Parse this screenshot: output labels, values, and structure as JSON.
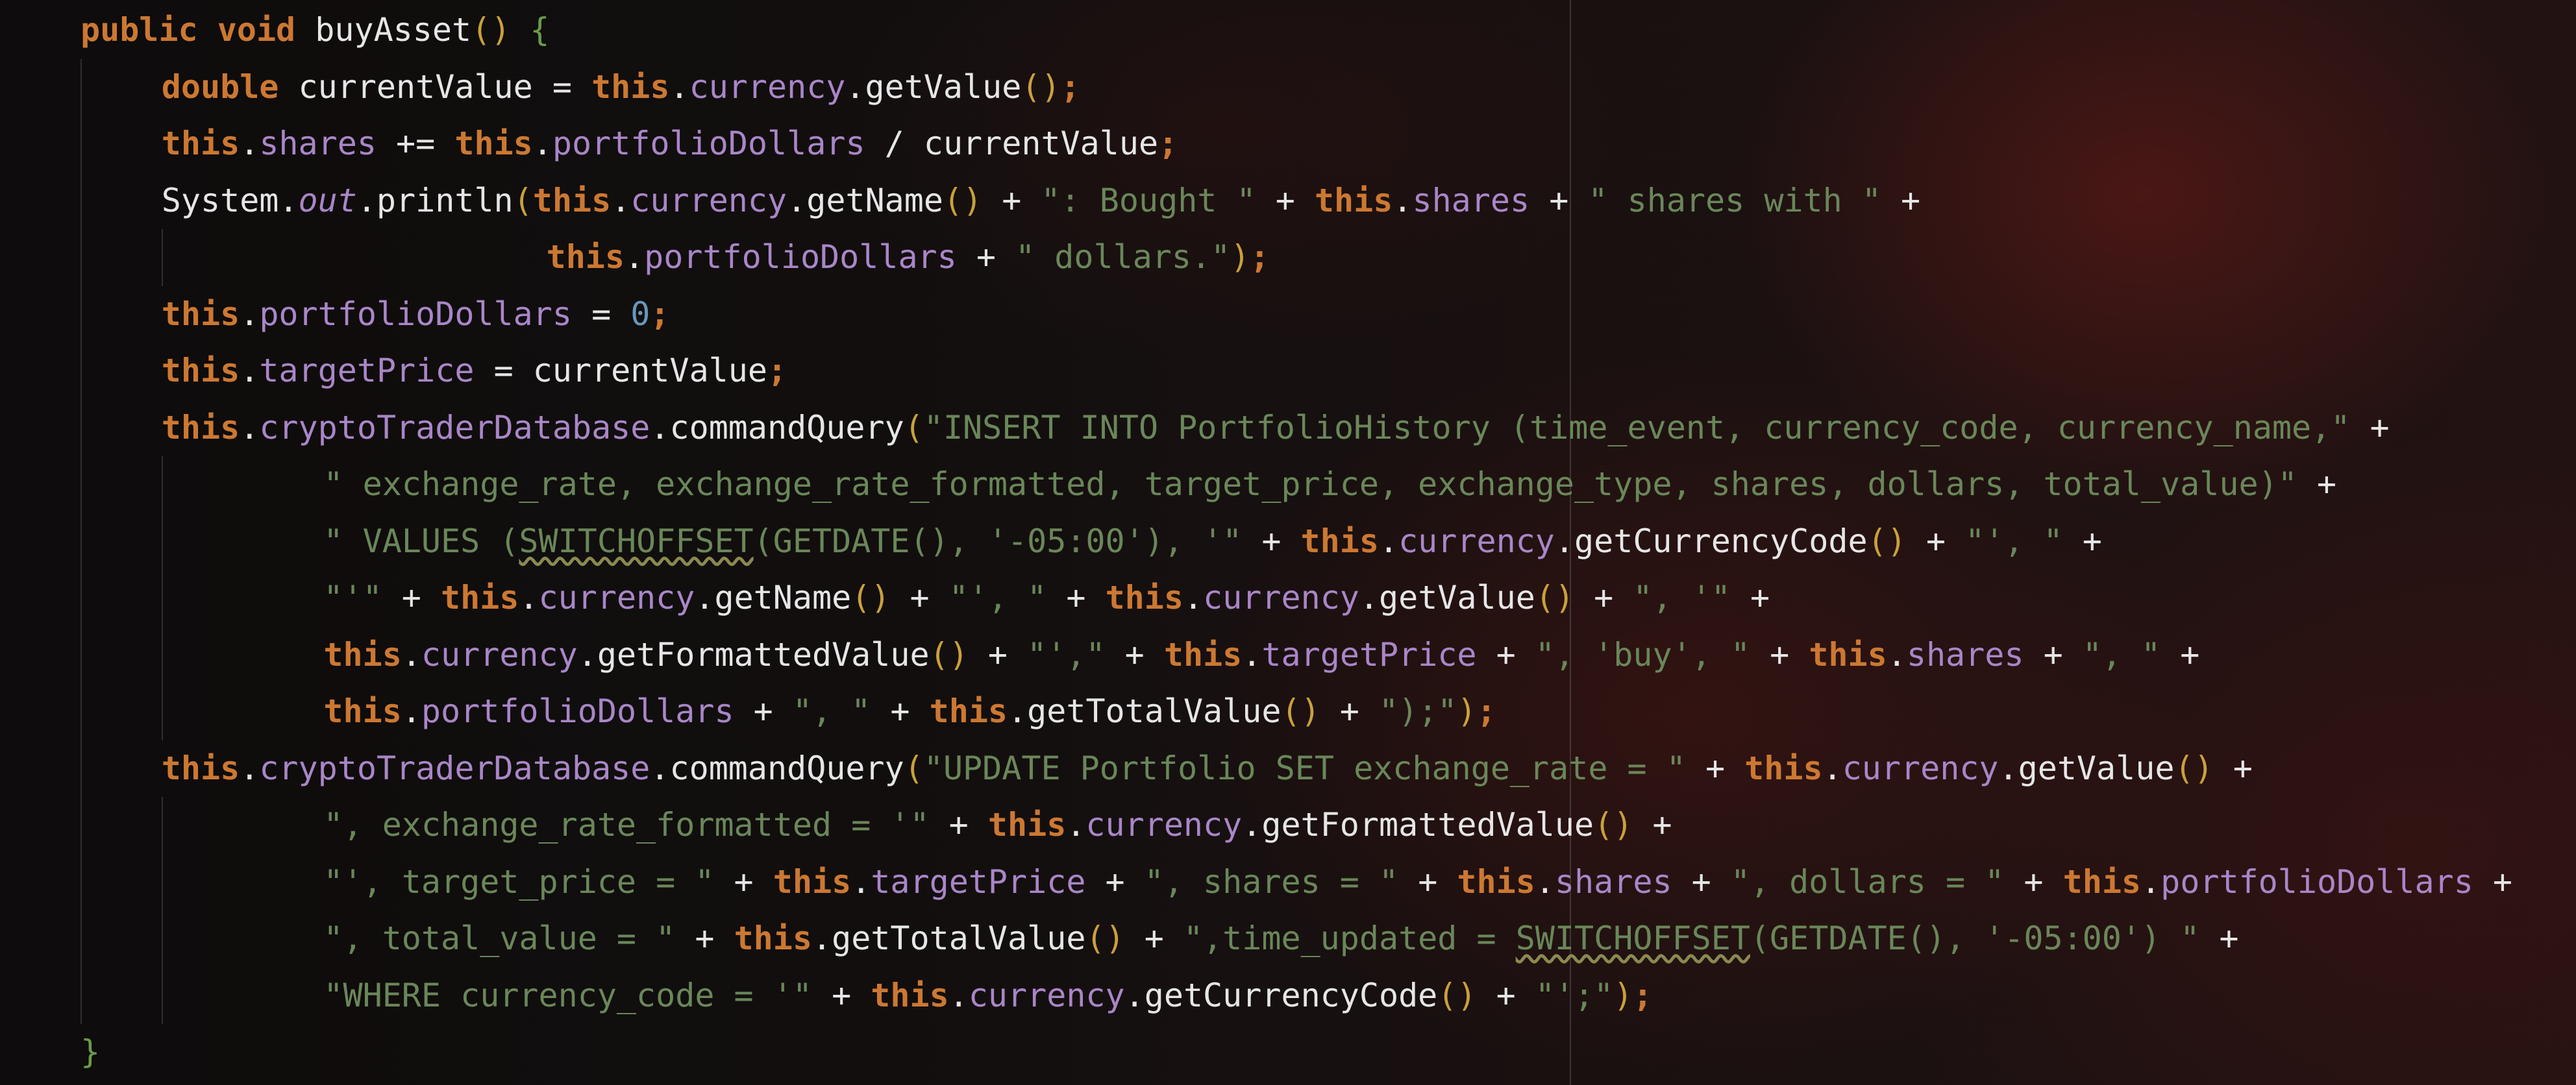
{
  "editor": {
    "language": "Java",
    "colors": {
      "keyword": "#cc7832",
      "field": "#a986c8",
      "string": "#6a8759",
      "number": "#6897bb",
      "paren": "#c9a13b",
      "text": "#e6e6e6"
    },
    "lines": [
      [
        {
          "t": "kw",
          "s": "public"
        },
        {
          "t": "plain",
          "s": " "
        },
        {
          "t": "kw",
          "s": "void"
        },
        {
          "t": "plain",
          "s": " buyAsset"
        },
        {
          "t": "paren",
          "s": "()"
        },
        {
          "t": "plain",
          "s": " "
        },
        {
          "t": "brace",
          "s": "{"
        }
      ],
      [
        {
          "t": "kw",
          "s": "double"
        },
        {
          "t": "plain",
          "s": " currentValue = "
        },
        {
          "t": "kw",
          "s": "this"
        },
        {
          "t": "plain",
          "s": "."
        },
        {
          "t": "fld",
          "s": "currency"
        },
        {
          "t": "plain",
          "s": ".getValue"
        },
        {
          "t": "paren",
          "s": "()"
        },
        {
          "t": "kw",
          "s": ";"
        }
      ],
      [
        {
          "t": "kw",
          "s": "this"
        },
        {
          "t": "plain",
          "s": "."
        },
        {
          "t": "fld",
          "s": "shares"
        },
        {
          "t": "plain",
          "s": " += "
        },
        {
          "t": "kw",
          "s": "this"
        },
        {
          "t": "plain",
          "s": "."
        },
        {
          "t": "fld",
          "s": "portfolioDollars"
        },
        {
          "t": "plain",
          "s": " / currentValue"
        },
        {
          "t": "kw",
          "s": ";"
        }
      ],
      [
        {
          "t": "plain",
          "s": "System."
        },
        {
          "t": "ital",
          "s": "out"
        },
        {
          "t": "plain",
          "s": ".println"
        },
        {
          "t": "paren",
          "s": "("
        },
        {
          "t": "kw",
          "s": "this"
        },
        {
          "t": "plain",
          "s": "."
        },
        {
          "t": "fld",
          "s": "currency"
        },
        {
          "t": "plain",
          "s": ".getName"
        },
        {
          "t": "paren",
          "s": "()"
        },
        {
          "t": "plain",
          "s": " + "
        },
        {
          "t": "str",
          "s": "\": Bought \""
        },
        {
          "t": "plain",
          "s": " + "
        },
        {
          "t": "kw",
          "s": "this"
        },
        {
          "t": "plain",
          "s": "."
        },
        {
          "t": "fld",
          "s": "shares"
        },
        {
          "t": "plain",
          "s": " + "
        },
        {
          "t": "str",
          "s": "\" shares with \""
        },
        {
          "t": "plain",
          "s": " +"
        }
      ],
      [
        {
          "t": "kw",
          "s": "this"
        },
        {
          "t": "plain",
          "s": "."
        },
        {
          "t": "fld",
          "s": "portfolioDollars"
        },
        {
          "t": "plain",
          "s": " + "
        },
        {
          "t": "str",
          "s": "\" dollars.\""
        },
        {
          "t": "paren",
          "s": ")"
        },
        {
          "t": "kw",
          "s": ";"
        }
      ],
      [
        {
          "t": "kw",
          "s": "this"
        },
        {
          "t": "plain",
          "s": "."
        },
        {
          "t": "fld",
          "s": "portfolioDollars"
        },
        {
          "t": "plain",
          "s": " = "
        },
        {
          "t": "num",
          "s": "0"
        },
        {
          "t": "kw",
          "s": ";"
        }
      ],
      [
        {
          "t": "kw",
          "s": "this"
        },
        {
          "t": "plain",
          "s": "."
        },
        {
          "t": "fld",
          "s": "targetPrice"
        },
        {
          "t": "plain",
          "s": " = currentValue"
        },
        {
          "t": "kw",
          "s": ";"
        }
      ],
      [
        {
          "t": "kw",
          "s": "this"
        },
        {
          "t": "plain",
          "s": "."
        },
        {
          "t": "fld",
          "s": "cryptoTraderDatabase"
        },
        {
          "t": "plain",
          "s": ".commandQuery"
        },
        {
          "t": "paren",
          "s": "("
        },
        {
          "t": "str",
          "s": "\"INSERT INTO PortfolioHistory (time_event, currency_code, currency_name,\""
        },
        {
          "t": "plain",
          "s": " +"
        }
      ],
      [
        {
          "t": "str",
          "s": "\" exchange_rate, exchange_rate_formatted, target_price, exchange_type, shares, dollars, total_value)\""
        },
        {
          "t": "plain",
          "s": " +"
        }
      ],
      [
        {
          "t": "str",
          "s": "\" VALUES ("
        },
        {
          "t": "str warn",
          "s": "SWITCHOFFSET"
        },
        {
          "t": "str",
          "s": "(GETDATE(), '-05:00'), '\""
        },
        {
          "t": "plain",
          "s": " + "
        },
        {
          "t": "kw",
          "s": "this"
        },
        {
          "t": "plain",
          "s": "."
        },
        {
          "t": "fld",
          "s": "currency"
        },
        {
          "t": "plain",
          "s": ".getCurrencyCode"
        },
        {
          "t": "paren",
          "s": "()"
        },
        {
          "t": "plain",
          "s": " + "
        },
        {
          "t": "str",
          "s": "\"', \""
        },
        {
          "t": "plain",
          "s": " +"
        }
      ],
      [
        {
          "t": "str",
          "s": "\"'\""
        },
        {
          "t": "plain",
          "s": " + "
        },
        {
          "t": "kw",
          "s": "this"
        },
        {
          "t": "plain",
          "s": "."
        },
        {
          "t": "fld",
          "s": "currency"
        },
        {
          "t": "plain",
          "s": ".getName"
        },
        {
          "t": "paren",
          "s": "()"
        },
        {
          "t": "plain",
          "s": " + "
        },
        {
          "t": "str",
          "s": "\"', \""
        },
        {
          "t": "plain",
          "s": " + "
        },
        {
          "t": "kw",
          "s": "this"
        },
        {
          "t": "plain",
          "s": "."
        },
        {
          "t": "fld",
          "s": "currency"
        },
        {
          "t": "plain",
          "s": ".getValue"
        },
        {
          "t": "paren",
          "s": "()"
        },
        {
          "t": "plain",
          "s": " + "
        },
        {
          "t": "str",
          "s": "\", '\""
        },
        {
          "t": "plain",
          "s": " +"
        }
      ],
      [
        {
          "t": "kw",
          "s": "this"
        },
        {
          "t": "plain",
          "s": "."
        },
        {
          "t": "fld",
          "s": "currency"
        },
        {
          "t": "plain",
          "s": ".getFormattedValue"
        },
        {
          "t": "paren",
          "s": "()"
        },
        {
          "t": "plain",
          "s": " + "
        },
        {
          "t": "str",
          "s": "\"',\""
        },
        {
          "t": "plain",
          "s": " + "
        },
        {
          "t": "kw",
          "s": "this"
        },
        {
          "t": "plain",
          "s": "."
        },
        {
          "t": "fld",
          "s": "targetPrice"
        },
        {
          "t": "plain",
          "s": " + "
        },
        {
          "t": "str",
          "s": "\", 'buy', \""
        },
        {
          "t": "plain",
          "s": " + "
        },
        {
          "t": "kw",
          "s": "this"
        },
        {
          "t": "plain",
          "s": "."
        },
        {
          "t": "fld",
          "s": "shares"
        },
        {
          "t": "plain",
          "s": " + "
        },
        {
          "t": "str",
          "s": "\", \""
        },
        {
          "t": "plain",
          "s": " +"
        }
      ],
      [
        {
          "t": "kw",
          "s": "this"
        },
        {
          "t": "plain",
          "s": "."
        },
        {
          "t": "fld",
          "s": "portfolioDollars"
        },
        {
          "t": "plain",
          "s": " + "
        },
        {
          "t": "str",
          "s": "\", \""
        },
        {
          "t": "plain",
          "s": " + "
        },
        {
          "t": "kw",
          "s": "this"
        },
        {
          "t": "plain",
          "s": ".getTotalValue"
        },
        {
          "t": "paren",
          "s": "()"
        },
        {
          "t": "plain",
          "s": " + "
        },
        {
          "t": "str",
          "s": "\");\""
        },
        {
          "t": "paren",
          "s": ")"
        },
        {
          "t": "kw",
          "s": ";"
        }
      ],
      [
        {
          "t": "kw",
          "s": "this"
        },
        {
          "t": "plain",
          "s": "."
        },
        {
          "t": "fld",
          "s": "cryptoTraderDatabase"
        },
        {
          "t": "plain",
          "s": ".commandQuery"
        },
        {
          "t": "paren",
          "s": "("
        },
        {
          "t": "str",
          "s": "\"UPDATE Portfolio SET exchange_rate = \""
        },
        {
          "t": "plain",
          "s": " + "
        },
        {
          "t": "kw",
          "s": "this"
        },
        {
          "t": "plain",
          "s": "."
        },
        {
          "t": "fld",
          "s": "currency"
        },
        {
          "t": "plain",
          "s": ".getValue"
        },
        {
          "t": "paren",
          "s": "()"
        },
        {
          "t": "plain",
          "s": " +"
        }
      ],
      [
        {
          "t": "str",
          "s": "\", exchange_rate_formatted = '\""
        },
        {
          "t": "plain",
          "s": " + "
        },
        {
          "t": "kw",
          "s": "this"
        },
        {
          "t": "plain",
          "s": "."
        },
        {
          "t": "fld",
          "s": "currency"
        },
        {
          "t": "plain",
          "s": ".getFormattedValue"
        },
        {
          "t": "paren",
          "s": "()"
        },
        {
          "t": "plain",
          "s": " +"
        }
      ],
      [
        {
          "t": "str",
          "s": "\"', target_price = \""
        },
        {
          "t": "plain",
          "s": " + "
        },
        {
          "t": "kw",
          "s": "this"
        },
        {
          "t": "plain",
          "s": "."
        },
        {
          "t": "fld",
          "s": "targetPrice"
        },
        {
          "t": "plain",
          "s": " + "
        },
        {
          "t": "str",
          "s": "\", shares = \""
        },
        {
          "t": "plain",
          "s": " + "
        },
        {
          "t": "kw",
          "s": "this"
        },
        {
          "t": "plain",
          "s": "."
        },
        {
          "t": "fld",
          "s": "shares"
        },
        {
          "t": "plain",
          "s": " + "
        },
        {
          "t": "str",
          "s": "\", dollars = \""
        },
        {
          "t": "plain",
          "s": " + "
        },
        {
          "t": "kw",
          "s": "this"
        },
        {
          "t": "plain",
          "s": "."
        },
        {
          "t": "fld",
          "s": "portfolioDollars"
        },
        {
          "t": "plain",
          "s": " +"
        }
      ],
      [
        {
          "t": "str",
          "s": "\", total_value = \""
        },
        {
          "t": "plain",
          "s": " + "
        },
        {
          "t": "kw",
          "s": "this"
        },
        {
          "t": "plain",
          "s": ".getTotalValue"
        },
        {
          "t": "paren",
          "s": "()"
        },
        {
          "t": "plain",
          "s": " + "
        },
        {
          "t": "str",
          "s": "\",time_updated = "
        },
        {
          "t": "str warn",
          "s": "SWITCHOFFSET"
        },
        {
          "t": "str",
          "s": "(GETDATE(), '-05:00') \""
        },
        {
          "t": "plain",
          "s": " +"
        }
      ],
      [
        {
          "t": "str",
          "s": "\"WHERE currency_code = '\""
        },
        {
          "t": "plain",
          "s": " + "
        },
        {
          "t": "kw",
          "s": "this"
        },
        {
          "t": "plain",
          "s": "."
        },
        {
          "t": "fld",
          "s": "currency"
        },
        {
          "t": "plain",
          "s": ".getCurrencyCode"
        },
        {
          "t": "paren",
          "s": "()"
        },
        {
          "t": "plain",
          "s": " + "
        },
        {
          "t": "str",
          "s": "\"';\""
        },
        {
          "t": "paren",
          "s": ")"
        },
        {
          "t": "kw",
          "s": ";"
        }
      ],
      [
        {
          "t": "brace",
          "s": "}"
        }
      ]
    ]
  }
}
